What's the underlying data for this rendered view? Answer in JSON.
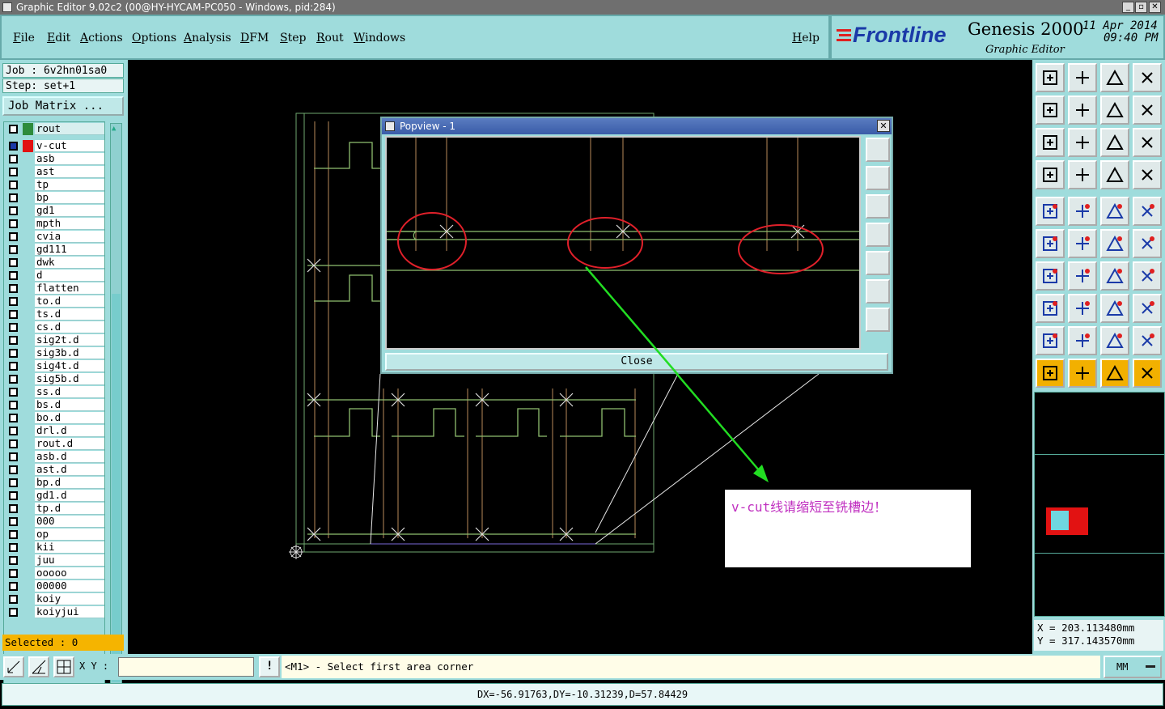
{
  "window": {
    "title": "Graphic Editor 9.02c2 (00@HY-HYCAM-PC050 - Windows, pid:284)"
  },
  "menu": {
    "items": [
      "File",
      "Edit",
      "Actions",
      "Options",
      "Analysis",
      "DFM",
      "Step",
      "Rout",
      "Windows"
    ],
    "help": "Help"
  },
  "brand": {
    "logo": "Frontline",
    "product": "Genesis 2000",
    "subtitle": "Graphic Editor",
    "date": "11 Apr 2014",
    "time": "09:40 PM"
  },
  "job": {
    "job_label": "Job  :  6v2hn01sa0",
    "step_label": "Step:  set+1",
    "matrix_button": "Job Matrix ..."
  },
  "layers": [
    "rout",
    "v-cut",
    "asb",
    "ast",
    "tp",
    "bp",
    "gd1",
    "mpth",
    "cvia",
    "gd111",
    "dwk",
    "d",
    "flatten",
    "to.d",
    "ts.d",
    "cs.d",
    "sig2t.d",
    "sig3b.d",
    "sig4t.d",
    "sig5b.d",
    "ss.d",
    "bs.d",
    "bo.d",
    "drl.d",
    "rout.d",
    "asb.d",
    "ast.d",
    "bp.d",
    "gd1.d",
    "tp.d",
    "000",
    "op",
    "kii",
    "juu",
    "ooooo",
    "00000",
    "koiy",
    "koiyjui"
  ],
  "selected": "Selected : 0",
  "coords": {
    "x": "X  =  203.113480mm",
    "y": "Y  =  317.143570mm"
  },
  "command": {
    "xy_label": "X Y :",
    "xy_value": "",
    "prompt": "<M1> - Select first area corner",
    "units": "MM"
  },
  "status": "DX=-56.91763,DY=-10.31239,D=57.84429",
  "popview": {
    "title": "Popview - 1",
    "close_label": "Close"
  },
  "annotation": "v-cut线请缩短至铣槽边！",
  "colors": {
    "panel": "#9fdcdc",
    "canvas": "#000000",
    "board_outline": "#6fa86f",
    "vcut_line": "#b98a5a",
    "highlight_circle": "#e0202a",
    "arrow": "#22dd22",
    "annotation_text": "#c030c0",
    "selected_bar": "#f5b400"
  }
}
